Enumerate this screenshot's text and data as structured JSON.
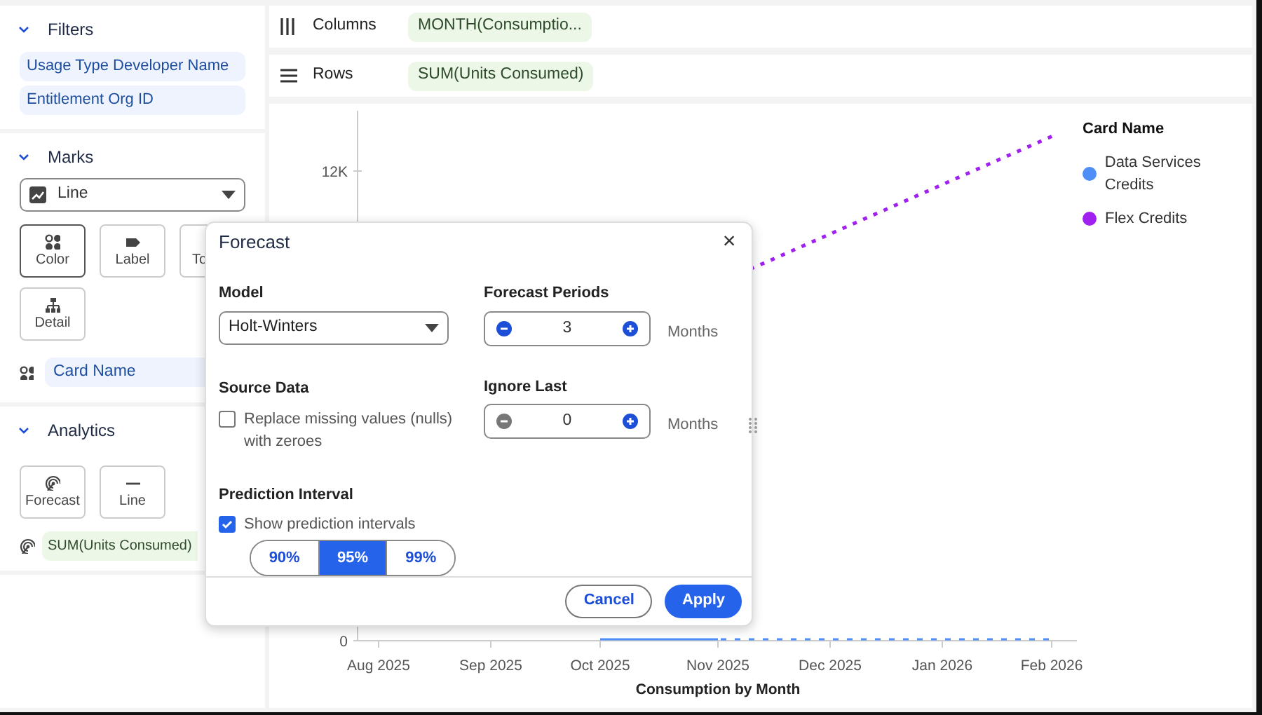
{
  "filters": {
    "title": "Filters",
    "expanded": true,
    "items": [
      "Usage Type Developer Name",
      "Entitlement Org ID"
    ]
  },
  "marks": {
    "title": "Marks",
    "expanded": true,
    "mark_type": "Line",
    "buttons": [
      {
        "label": "Color",
        "kind": "color",
        "selected": true
      },
      {
        "label": "Label",
        "kind": "label",
        "selected": false
      },
      {
        "label": "To",
        "kind": "tooltip",
        "selected": false
      },
      {
        "label": "Detail",
        "kind": "detail",
        "selected": false
      }
    ],
    "fields": [
      {
        "label": "Card Name",
        "kind": "color"
      }
    ]
  },
  "analytics": {
    "title": "Analytics",
    "expanded": true,
    "buttons": [
      {
        "label": "Forecast",
        "kind": "forecast"
      },
      {
        "label": "Line",
        "kind": "line"
      }
    ],
    "fields": [
      {
        "label": "SUM(Units Consumed)",
        "kind": "forecast"
      }
    ]
  },
  "shelves": [
    {
      "label": "Columns",
      "kind": "columns",
      "pill": "MONTH(Consumptio..."
    },
    {
      "label": "Rows",
      "kind": "rows",
      "pill": "SUM(Units Consumed)"
    }
  ],
  "chart": {
    "y_ticks": [
      "12K",
      "0"
    ],
    "x_ticks": [
      "Aug 2025",
      "Sep 2025",
      "Oct 2025",
      "Nov 2025",
      "Dec 2025",
      "Jan 2026",
      "Feb 2026"
    ],
    "xlabel": "Consumption by Month",
    "legend": {
      "title": "Card Name",
      "items": [
        {
          "label": "Data Services Credits",
          "color": "#4f8ef7"
        },
        {
          "label": "Flex Credits",
          "color": "#a020f0"
        }
      ]
    }
  },
  "dialog": {
    "title": "Forecast",
    "close": "×",
    "model": {
      "label": "Model",
      "value": "Holt-Winters"
    },
    "source_data": {
      "label": "Source Data",
      "checkbox": "Replace missing values (nulls) with zeroes",
      "checked": false
    },
    "steppers": [
      {
        "label": "Forecast Periods",
        "value": "3",
        "unit": "Months",
        "minus_disabled": false
      },
      {
        "label": "Ignore Last",
        "value": "0",
        "unit": "Months",
        "minus_disabled": true
      }
    ],
    "prediction": {
      "label": "Prediction Interval",
      "checkbox": "Show prediction intervals",
      "checked": true,
      "options": [
        {
          "label": "90%",
          "selected": false
        },
        {
          "label": "95%",
          "selected": true
        },
        {
          "label": "99%",
          "selected": false
        }
      ]
    },
    "buttons": [
      {
        "label": "Cancel",
        "kind": "secondary"
      },
      {
        "label": "Apply",
        "kind": "primary"
      }
    ]
  }
}
